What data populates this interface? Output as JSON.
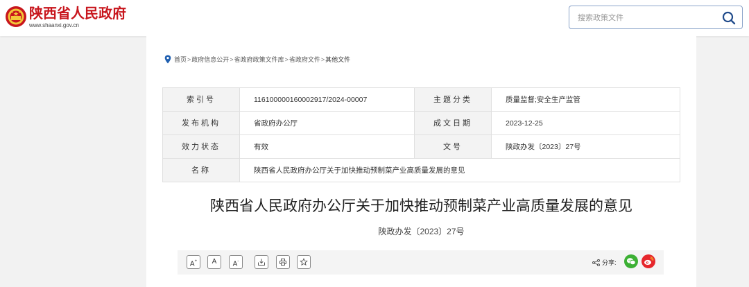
{
  "header": {
    "site_name": "陕西省人民政府",
    "site_domain": "www.shaanxi.gov.cn",
    "search": {
      "placeholder": "搜索政策文件"
    }
  },
  "breadcrumb": [
    "首页",
    "政府信息公开",
    "省政府政策文件库",
    "省政府文件",
    "其他文件"
  ],
  "breadcrumb_sep": ">",
  "meta_table": {
    "index_label": "索引号",
    "index_value": "116100000160002917/2024-00007",
    "category_label": "主题分类",
    "category_value": "质量监督;安全生产监管",
    "issuer_label": "发布机构",
    "issuer_value": "省政府办公厅",
    "date_label": "成文日期",
    "date_value": "2023-12-25",
    "status_label": "效力状态",
    "status_value": "有效",
    "docno_label": "文号",
    "docno_value": "陕政办发〔2023〕27号",
    "name_label": "名称",
    "name_value": "陕西省人民政府办公厅关于加快推动预制菜产业高质量发展的意见"
  },
  "document": {
    "title": "陕西省人民政府办公厅关于加快推动预制菜产业高质量发展的意见",
    "number": "陕政办发〔2023〕27号"
  },
  "toolbar": {
    "font_increase": "A",
    "font_increase_sup": "+",
    "font_normal": "A",
    "font_decrease": "A",
    "font_decrease_sup": "-",
    "share_label": "分享:",
    "icons": [
      "download-icon",
      "print-icon",
      "star-icon",
      "share-icon",
      "wechat-icon",
      "weibo-icon"
    ]
  },
  "colors": {
    "brand_red": "#c8161d",
    "search_accent": "#1f4a8a",
    "wechat_green": "#3cb034",
    "weibo_red": "#e6262c"
  }
}
